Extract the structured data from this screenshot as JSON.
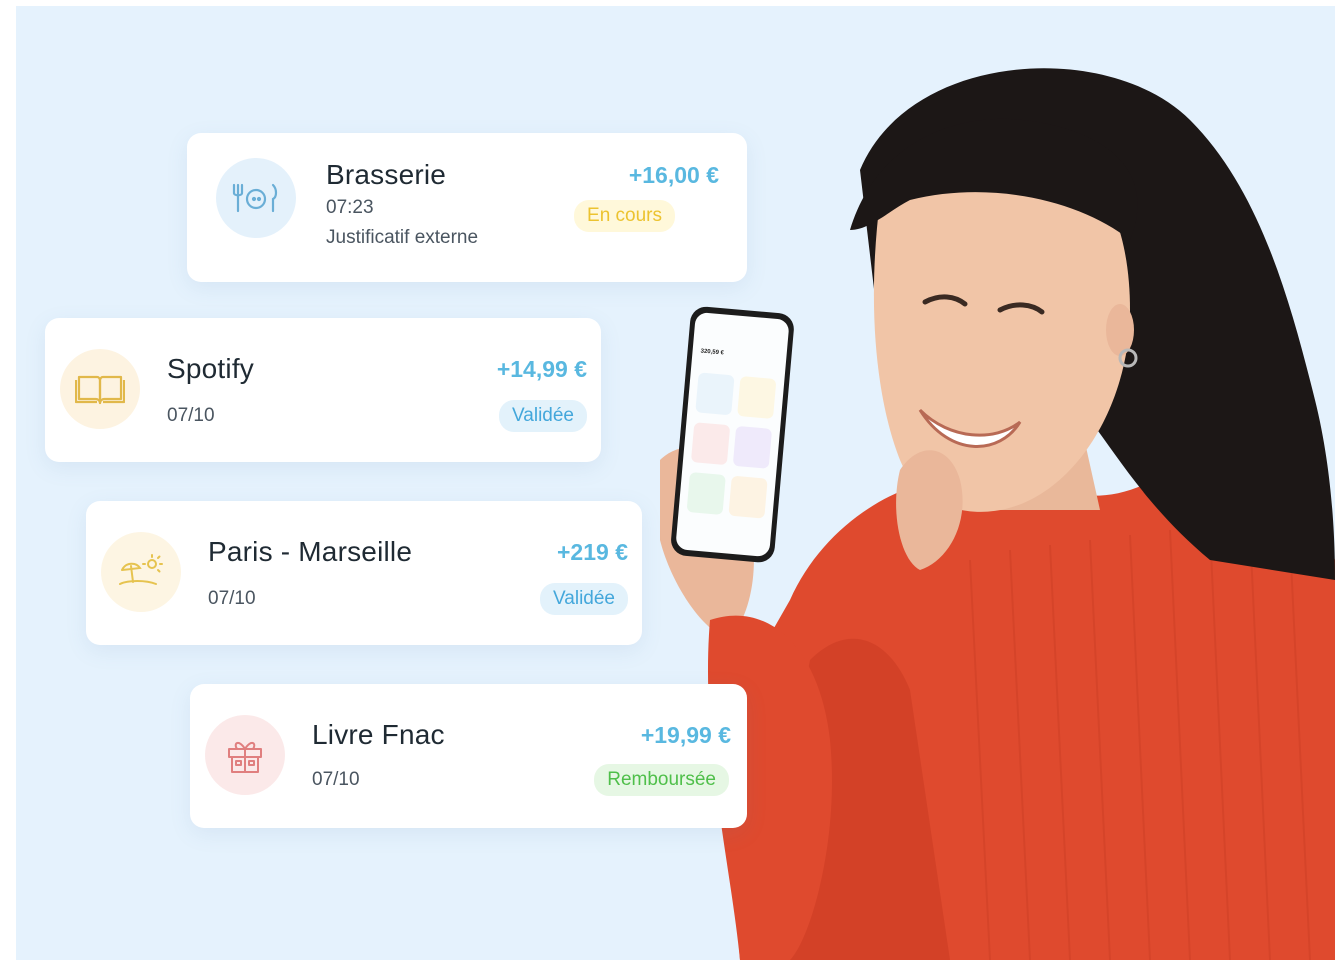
{
  "transactions": [
    {
      "title": "Brasserie",
      "date": "07:23",
      "note": "Justificatif externe",
      "amount": "+16,00 €",
      "status": "En cours",
      "icon": "restaurant-icon",
      "icon_color": "#6aaed6",
      "circle_color": "#e4f1fb",
      "status_color": "#ecc330"
    },
    {
      "title": "Spotify",
      "date": "07/10",
      "amount": "+14,99 €",
      "status": "Validée",
      "icon": "book-icon",
      "icon_color": "#e1b84a",
      "circle_color": "#fdf3e1",
      "status_color": "#43a7db"
    },
    {
      "title": "Paris - Marseille",
      "date": "07/10",
      "amount": "+219 €",
      "status": "Validée",
      "icon": "beach-icon",
      "icon_color": "#e6c34f",
      "circle_color": "#fdf5e3",
      "status_color": "#43a7db"
    },
    {
      "title": "Livre Fnac",
      "date": "07/10",
      "amount": "+19,99 €",
      "status": "Remboursée",
      "icon": "gift-icon",
      "icon_color": "#e07f7f",
      "circle_color": "#fbe9e9",
      "status_color": "#4fbf4a"
    }
  ],
  "phone": {
    "balance": "320,59 €"
  },
  "colors": {
    "background": "#e5f2fd",
    "amount": "#59b8e0",
    "sweater": "#e0452c"
  }
}
